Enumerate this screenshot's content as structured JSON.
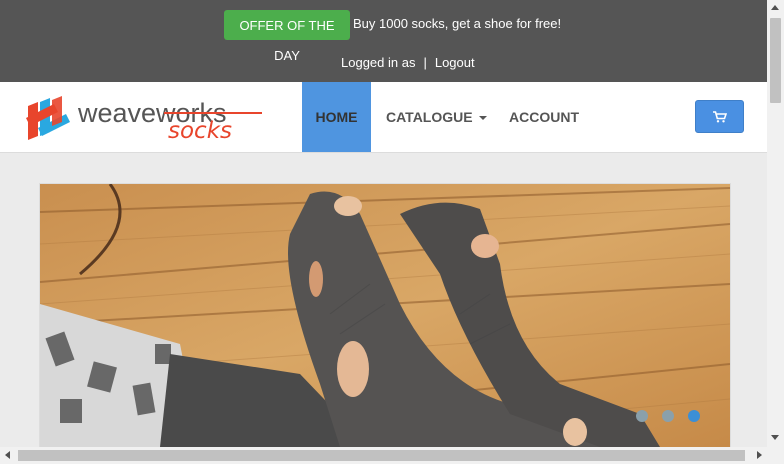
{
  "topbar": {
    "offer_button": "OFFER OF THE DAY",
    "offer_text": "Buy 1000 socks, get a shoe for free!",
    "logged_in": "Logged in as",
    "separator": "|",
    "logout": "Logout"
  },
  "logo": {
    "brand": "weaveworks",
    "sub": "socks"
  },
  "nav": {
    "home": "HOME",
    "catalogue": "CATALOGUE",
    "account": "ACCOUNT"
  },
  "cart": {
    "icon": "cart-icon"
  },
  "carousel": {
    "slide_count": 3,
    "active_slide": 3
  },
  "colors": {
    "topbar": "#555555",
    "offer": "#4cae4c",
    "accent": "#4a90e2",
    "logo_red": "#e8452c",
    "logo_blue": "#2aa8e0"
  }
}
